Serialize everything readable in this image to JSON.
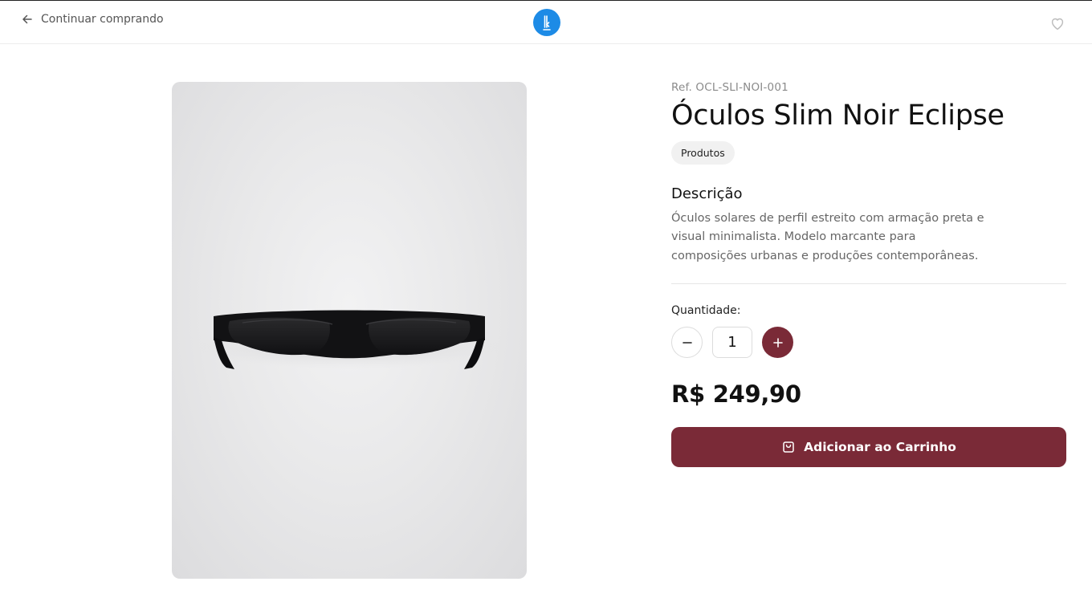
{
  "header": {
    "back_label": "Continuar comprando",
    "logo_icon": "brand-logo-icon",
    "favorite_icon": "heart-icon"
  },
  "product": {
    "ref": "Ref. OCL-SLI-NOI-001",
    "name": "Óculos Slim Noir Eclipse",
    "category": "Produtos",
    "description_title": "Descrição",
    "description": "Óculos solares de perfil estreito com armação preta e visual minimalista. Modelo marcante para composições urbanas e produções contemporâneas.",
    "image_alt_icon": "sunglasses-image"
  },
  "quantity": {
    "label": "Quantidade:",
    "value": "1",
    "minus_icon": "minus-icon",
    "plus_icon": "plus-icon"
  },
  "price": "R$ 249,90",
  "cart": {
    "label": "Adicionar ao Carrinho",
    "icon": "shopping-bag-icon"
  },
  "colors": {
    "accent": "#7a2a37",
    "logo": "#1d8be6"
  }
}
